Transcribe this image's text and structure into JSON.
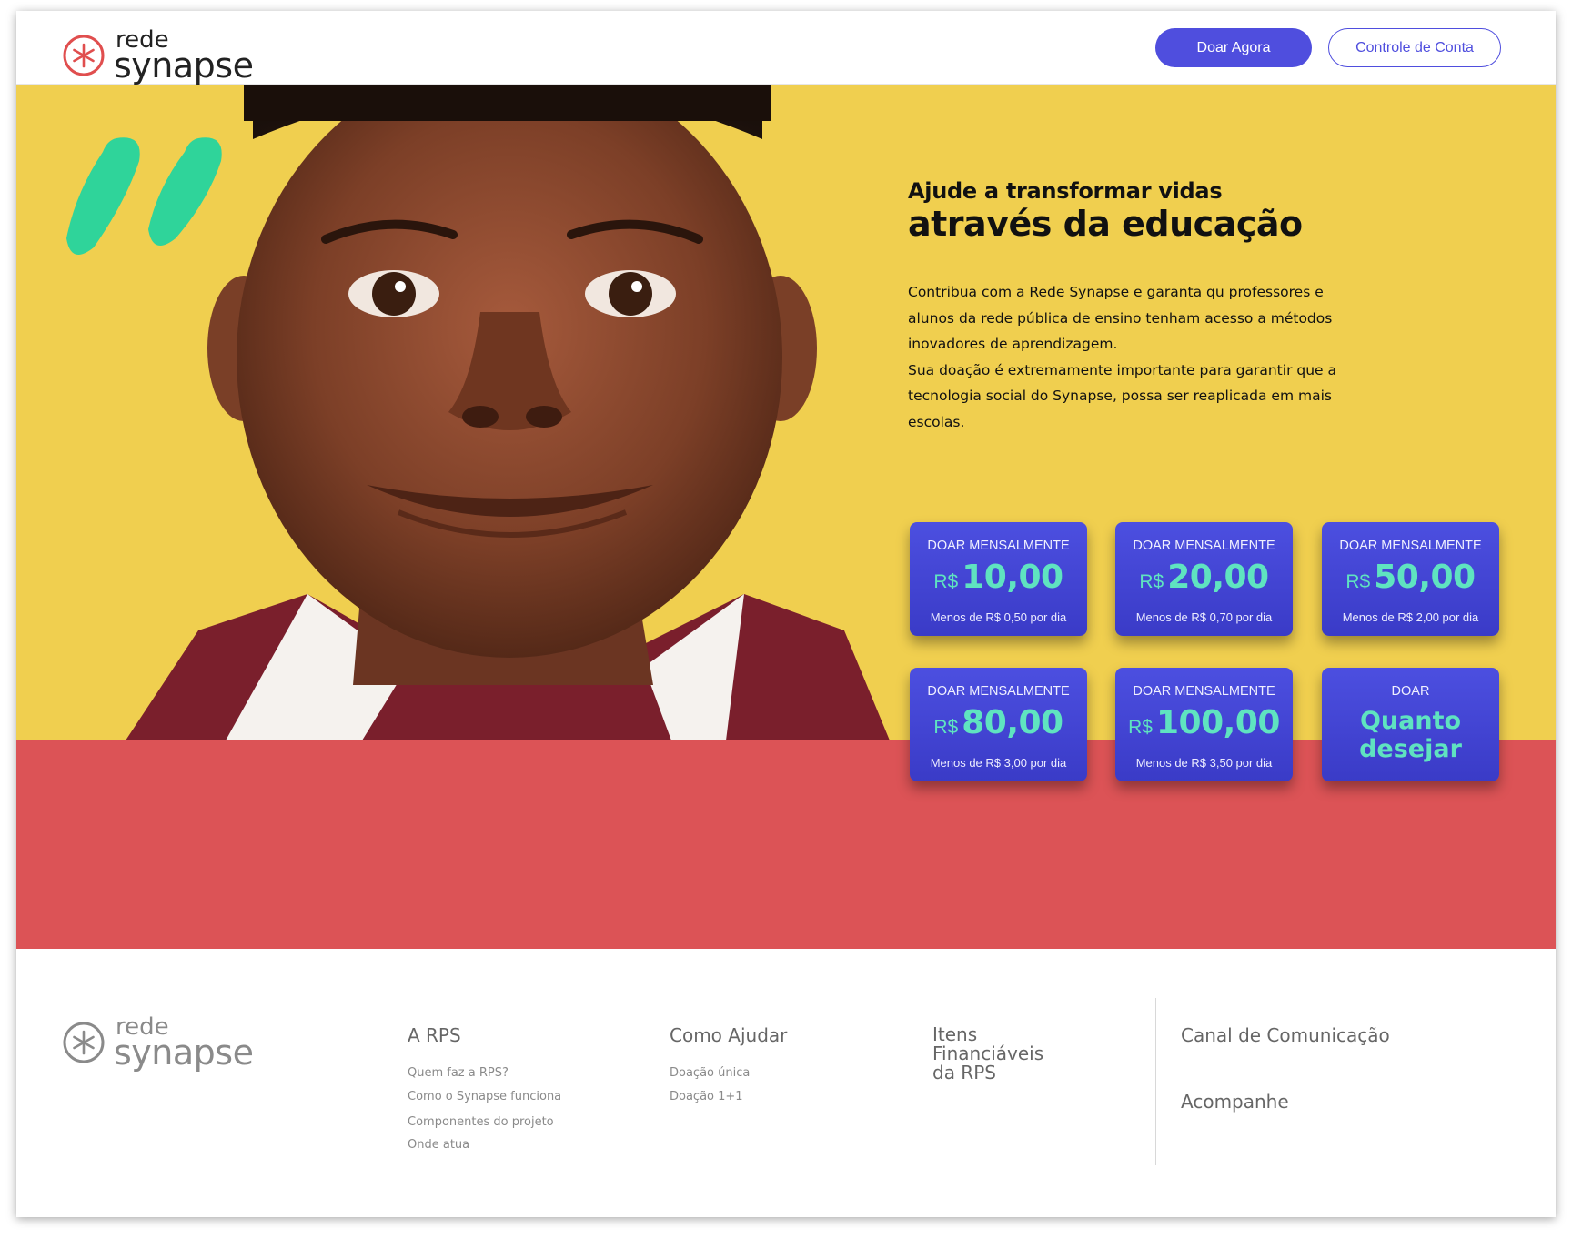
{
  "header": {
    "logo": {
      "line1": "rede",
      "line2": "synapse"
    },
    "donate_button": "Doar Agora",
    "account_button": "Controle de Conta"
  },
  "hero": {
    "subtitle": "Ajude a transformar vidas",
    "title": "através da educação",
    "paragraph1": "Contribua com a Rede Synapse e garanta qu professores e alunos da rede pública de ensino tenham acesso a métodos inovadores de aprendizagem.",
    "paragraph2": "Sua doação é extremamente importante para garantir que a tecnologia social do Synapse, possa ser reaplicada em mais escolas."
  },
  "donation_cards": [
    {
      "label": "DOAR MENSALMENTE",
      "currency": "R$",
      "amount": "10,00",
      "note": "Menos de R$ 0,50 por dia"
    },
    {
      "label": "DOAR MENSALMENTE",
      "currency": "R$",
      "amount": "20,00",
      "note": "Menos de R$ 0,70 por dia"
    },
    {
      "label": "DOAR MENSALMENTE",
      "currency": "R$",
      "amount": "50,00",
      "note": "Menos de R$ 2,00 por dia"
    },
    {
      "label": "DOAR MENSALMENTE",
      "currency": "R$",
      "amount": "80,00",
      "note": "Menos de R$ 3,00 por dia"
    },
    {
      "label": "DOAR MENSALMENTE",
      "currency": "R$",
      "amount": "100,00",
      "note": "Menos de R$ 3,50 por dia"
    },
    {
      "label": "DOAR",
      "custom_line1": "Quanto",
      "custom_line2": "desejar"
    }
  ],
  "footer": {
    "logo": {
      "line1": "rede",
      "line2": "synapse"
    },
    "columns": [
      {
        "heading": "A RPS",
        "links": [
          "Quem faz a RPS?",
          "Como o Synapse funciona",
          "Componentes do projeto",
          "Onde atua"
        ]
      },
      {
        "heading": "Como Ajudar",
        "links": [
          "Doação única",
          "Doação 1+1"
        ]
      },
      {
        "heading_lines": [
          "Itens",
          "Financiáveis",
          "da RPS"
        ]
      },
      {
        "heading": "Canal de Comunicação",
        "heading2": "Acompanhe"
      }
    ]
  },
  "colors": {
    "accent": "#4f4ede",
    "hero_yellow": "#f0cf4f",
    "band_red": "#dc5356",
    "amount_green": "#5fe3c0",
    "quote_green": "#2fd49a",
    "logo_red": "#e04e4e"
  },
  "icons": {
    "logo": "asterisk-circle-icon",
    "quote": "quote-marks-icon"
  }
}
